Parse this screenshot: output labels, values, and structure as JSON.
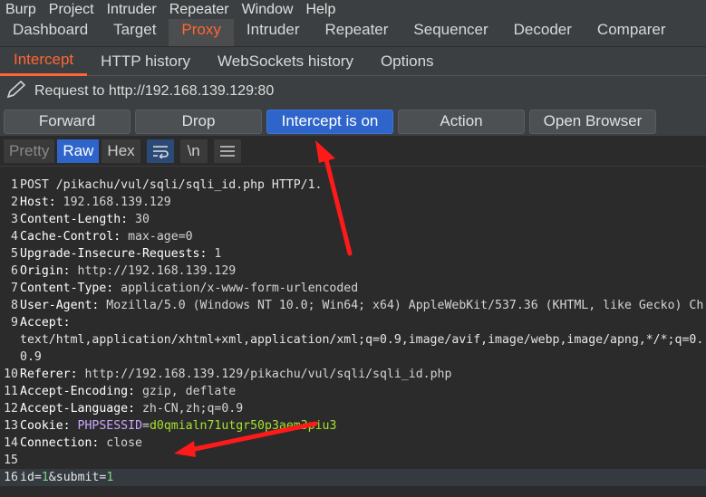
{
  "menubar": [
    "Burp",
    "Project",
    "Intruder",
    "Repeater",
    "Window",
    "Help"
  ],
  "main_tabs": [
    {
      "label": "Dashboard",
      "active": false
    },
    {
      "label": "Target",
      "active": false
    },
    {
      "label": "Proxy",
      "active": true
    },
    {
      "label": "Intruder",
      "active": false
    },
    {
      "label": "Repeater",
      "active": false
    },
    {
      "label": "Sequencer",
      "active": false
    },
    {
      "label": "Decoder",
      "active": false
    },
    {
      "label": "Comparer",
      "active": false
    }
  ],
  "proxy_tabs": [
    {
      "label": "Intercept",
      "active": true
    },
    {
      "label": "HTTP history",
      "active": false
    },
    {
      "label": "WebSockets history",
      "active": false
    },
    {
      "label": "Options",
      "active": false
    }
  ],
  "request_target": "Request to http://192.168.139.129:80",
  "buttons": {
    "forward": "Forward",
    "drop": "Drop",
    "intercept": "Intercept is on",
    "action": "Action",
    "open_browser": "Open Browser"
  },
  "view_modes": {
    "pretty": "Pretty",
    "raw": "Raw",
    "hex": "Hex",
    "newline": "\\n"
  },
  "request_lines": [
    {
      "num": "1",
      "text": "POST /pikachu/vul/sqli/sqli_id.php HTTP/1."
    },
    {
      "num": "2",
      "key": "Host",
      "value": " 192.168.139.129"
    },
    {
      "num": "3",
      "key": "Content-Length",
      "value": " 30"
    },
    {
      "num": "4",
      "key": "Cache-Control",
      "value": " max-age=0"
    },
    {
      "num": "5",
      "key": "Upgrade-Insecure-Requests",
      "value": " 1"
    },
    {
      "num": "6",
      "key": "Origin",
      "value": " http://192.168.139.129"
    },
    {
      "num": "7",
      "key": "Content-Type",
      "value": " application/x-www-form-urlencoded"
    },
    {
      "num": "8",
      "key": "User-Agent",
      "value": " Mozilla/5.0 (Windows NT 10.0; Win64; x64) AppleWebKit/537.36 (KHTML, like Gecko) Ch"
    },
    {
      "num": "9",
      "key": "Accept",
      "value": ""
    },
    {
      "num": "",
      "text": "text/html,application/xhtml+xml,application/xml;q=0.9,image/avif,image/webp,image/apng,*/*;q=0."
    },
    {
      "num": "",
      "text": "0.9"
    },
    {
      "num": "10",
      "key": "Referer",
      "value": " http://192.168.139.129/pikachu/vul/sqli/sqli_id.php"
    },
    {
      "num": "11",
      "key": "Accept-Encoding",
      "value": " gzip, deflate"
    },
    {
      "num": "12",
      "key": "Accept-Language",
      "value": " zh-CN,zh;q=0.9"
    },
    {
      "num": "13",
      "key": "Cookie",
      "value": " ",
      "cookie_name": "PHPSESSID",
      "cookie_value": "d0qmialn71utgr50p3aem3piu3"
    },
    {
      "num": "14",
      "key": "Connection",
      "value": " close"
    },
    {
      "num": "15",
      "text": ""
    },
    {
      "num": "16",
      "body": [
        {
          "k": "id",
          "v": "1"
        },
        {
          "k": "submit",
          "v": "1"
        }
      ]
    }
  ],
  "annotation_color": "#ff1a1a",
  "accent_color": "#ff6633",
  "intercept_on_color": "#2f65ca"
}
